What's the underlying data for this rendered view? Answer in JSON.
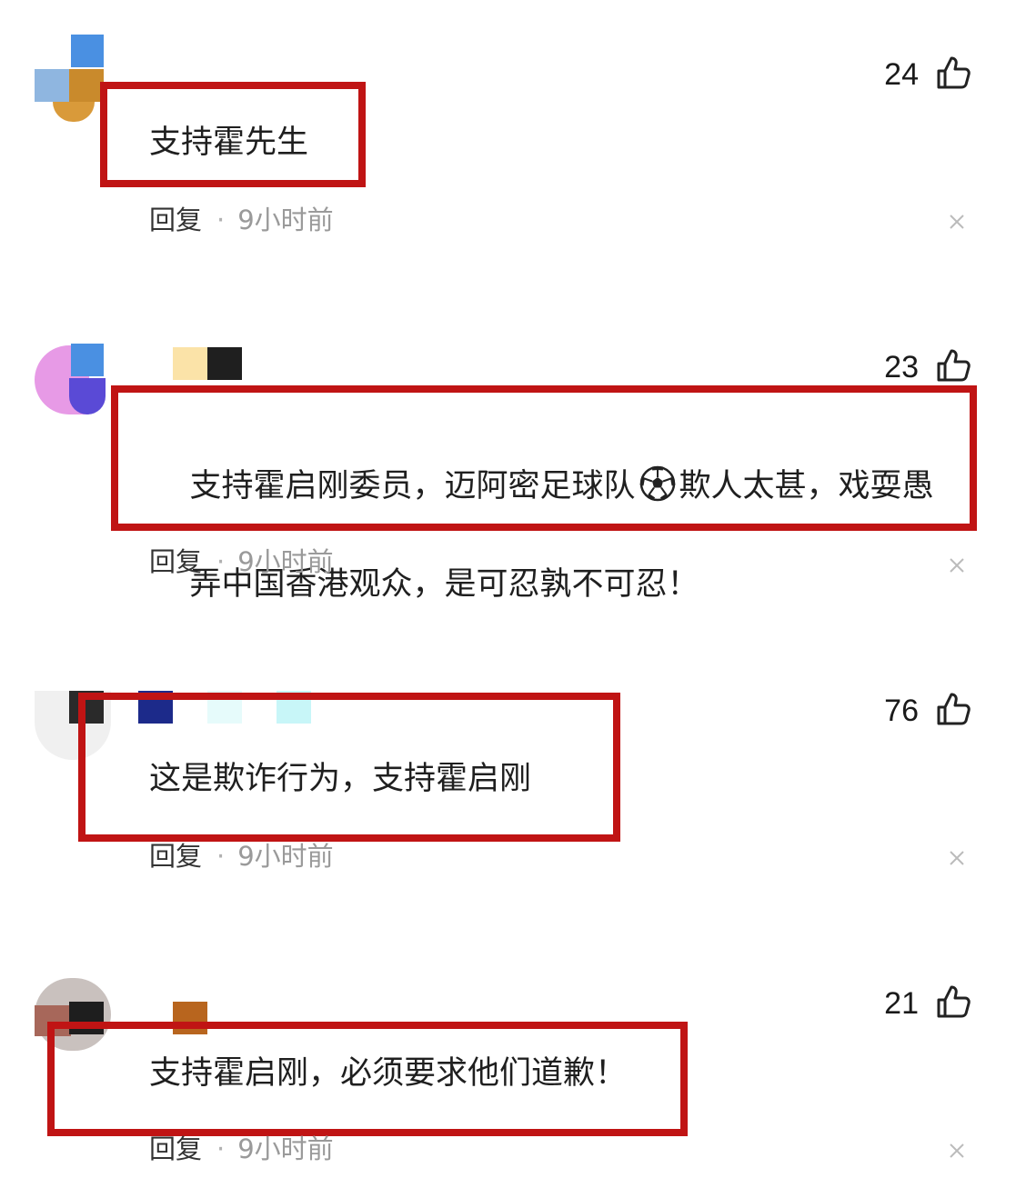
{
  "reply_label": "回复",
  "separator": "·",
  "comments": [
    {
      "likes": "24",
      "text": "支持霍先生",
      "time": "9小时前"
    },
    {
      "likes": "23",
      "text_before_icon": "支持霍启刚委员，迈阿密足球队",
      "inline_icon": "soccer-ball-icon",
      "text_after_icon": "欺人太甚，戏耍愚",
      "text_line2": "弄中国香港观众，是可忍孰不可忍！",
      "time": "9小时前"
    },
    {
      "likes": "76",
      "text": "这是欺诈行为，支持霍启刚",
      "time": "9小时前"
    },
    {
      "likes": "21",
      "text": "支持霍启刚，必须要求他们道歉！",
      "time": "9小时前"
    }
  ],
  "icons": {
    "like": "thumbs-up-icon",
    "dismiss": "close-icon"
  },
  "colors": {
    "highlight_border": "#c01414",
    "timestamp": "#9a9a9a",
    "separator": "#b0b0b0"
  }
}
